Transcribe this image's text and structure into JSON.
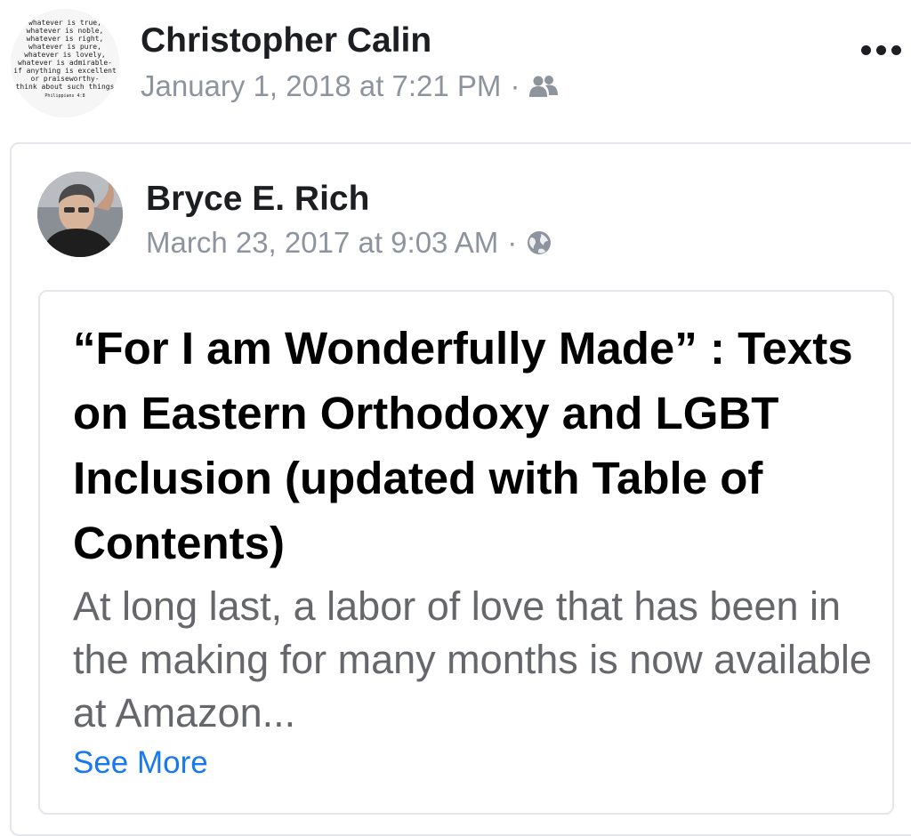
{
  "post": {
    "author": "Christopher Calin",
    "timestamp": "January 1, 2018 at 7:21 PM",
    "separator": "·",
    "privacy_icon": "friends-icon",
    "more_icon": "more-options-icon",
    "avatar_text": [
      "whatever is true,",
      "whatever is noble,",
      "whatever is right,",
      "whatever is pure,",
      "whatever is lovely,",
      "whatever is admirable-",
      "if anything is excellent",
      "or praiseworthy-",
      "think about such things",
      "Philippians 4:8"
    ]
  },
  "shared_post": {
    "author": "Bryce E. Rich",
    "timestamp": "March 23, 2017 at 9:03 AM",
    "separator": "·",
    "privacy_icon": "globe-icon",
    "note": {
      "title": "“For I am Wonderfully Made” : Texts on Eastern Orthodoxy and LGBT Inclusion (updated with Table of Contents)",
      "excerpt": "At long last, a labor of love that has been in the making for many months is now available at Amazon...",
      "see_more": "See More"
    }
  },
  "colors": {
    "text_primary": "#1c1e21",
    "text_secondary": "#8d949e",
    "excerpt": "#65676b",
    "link": "#1877f2",
    "border": "#e4e6eb"
  }
}
